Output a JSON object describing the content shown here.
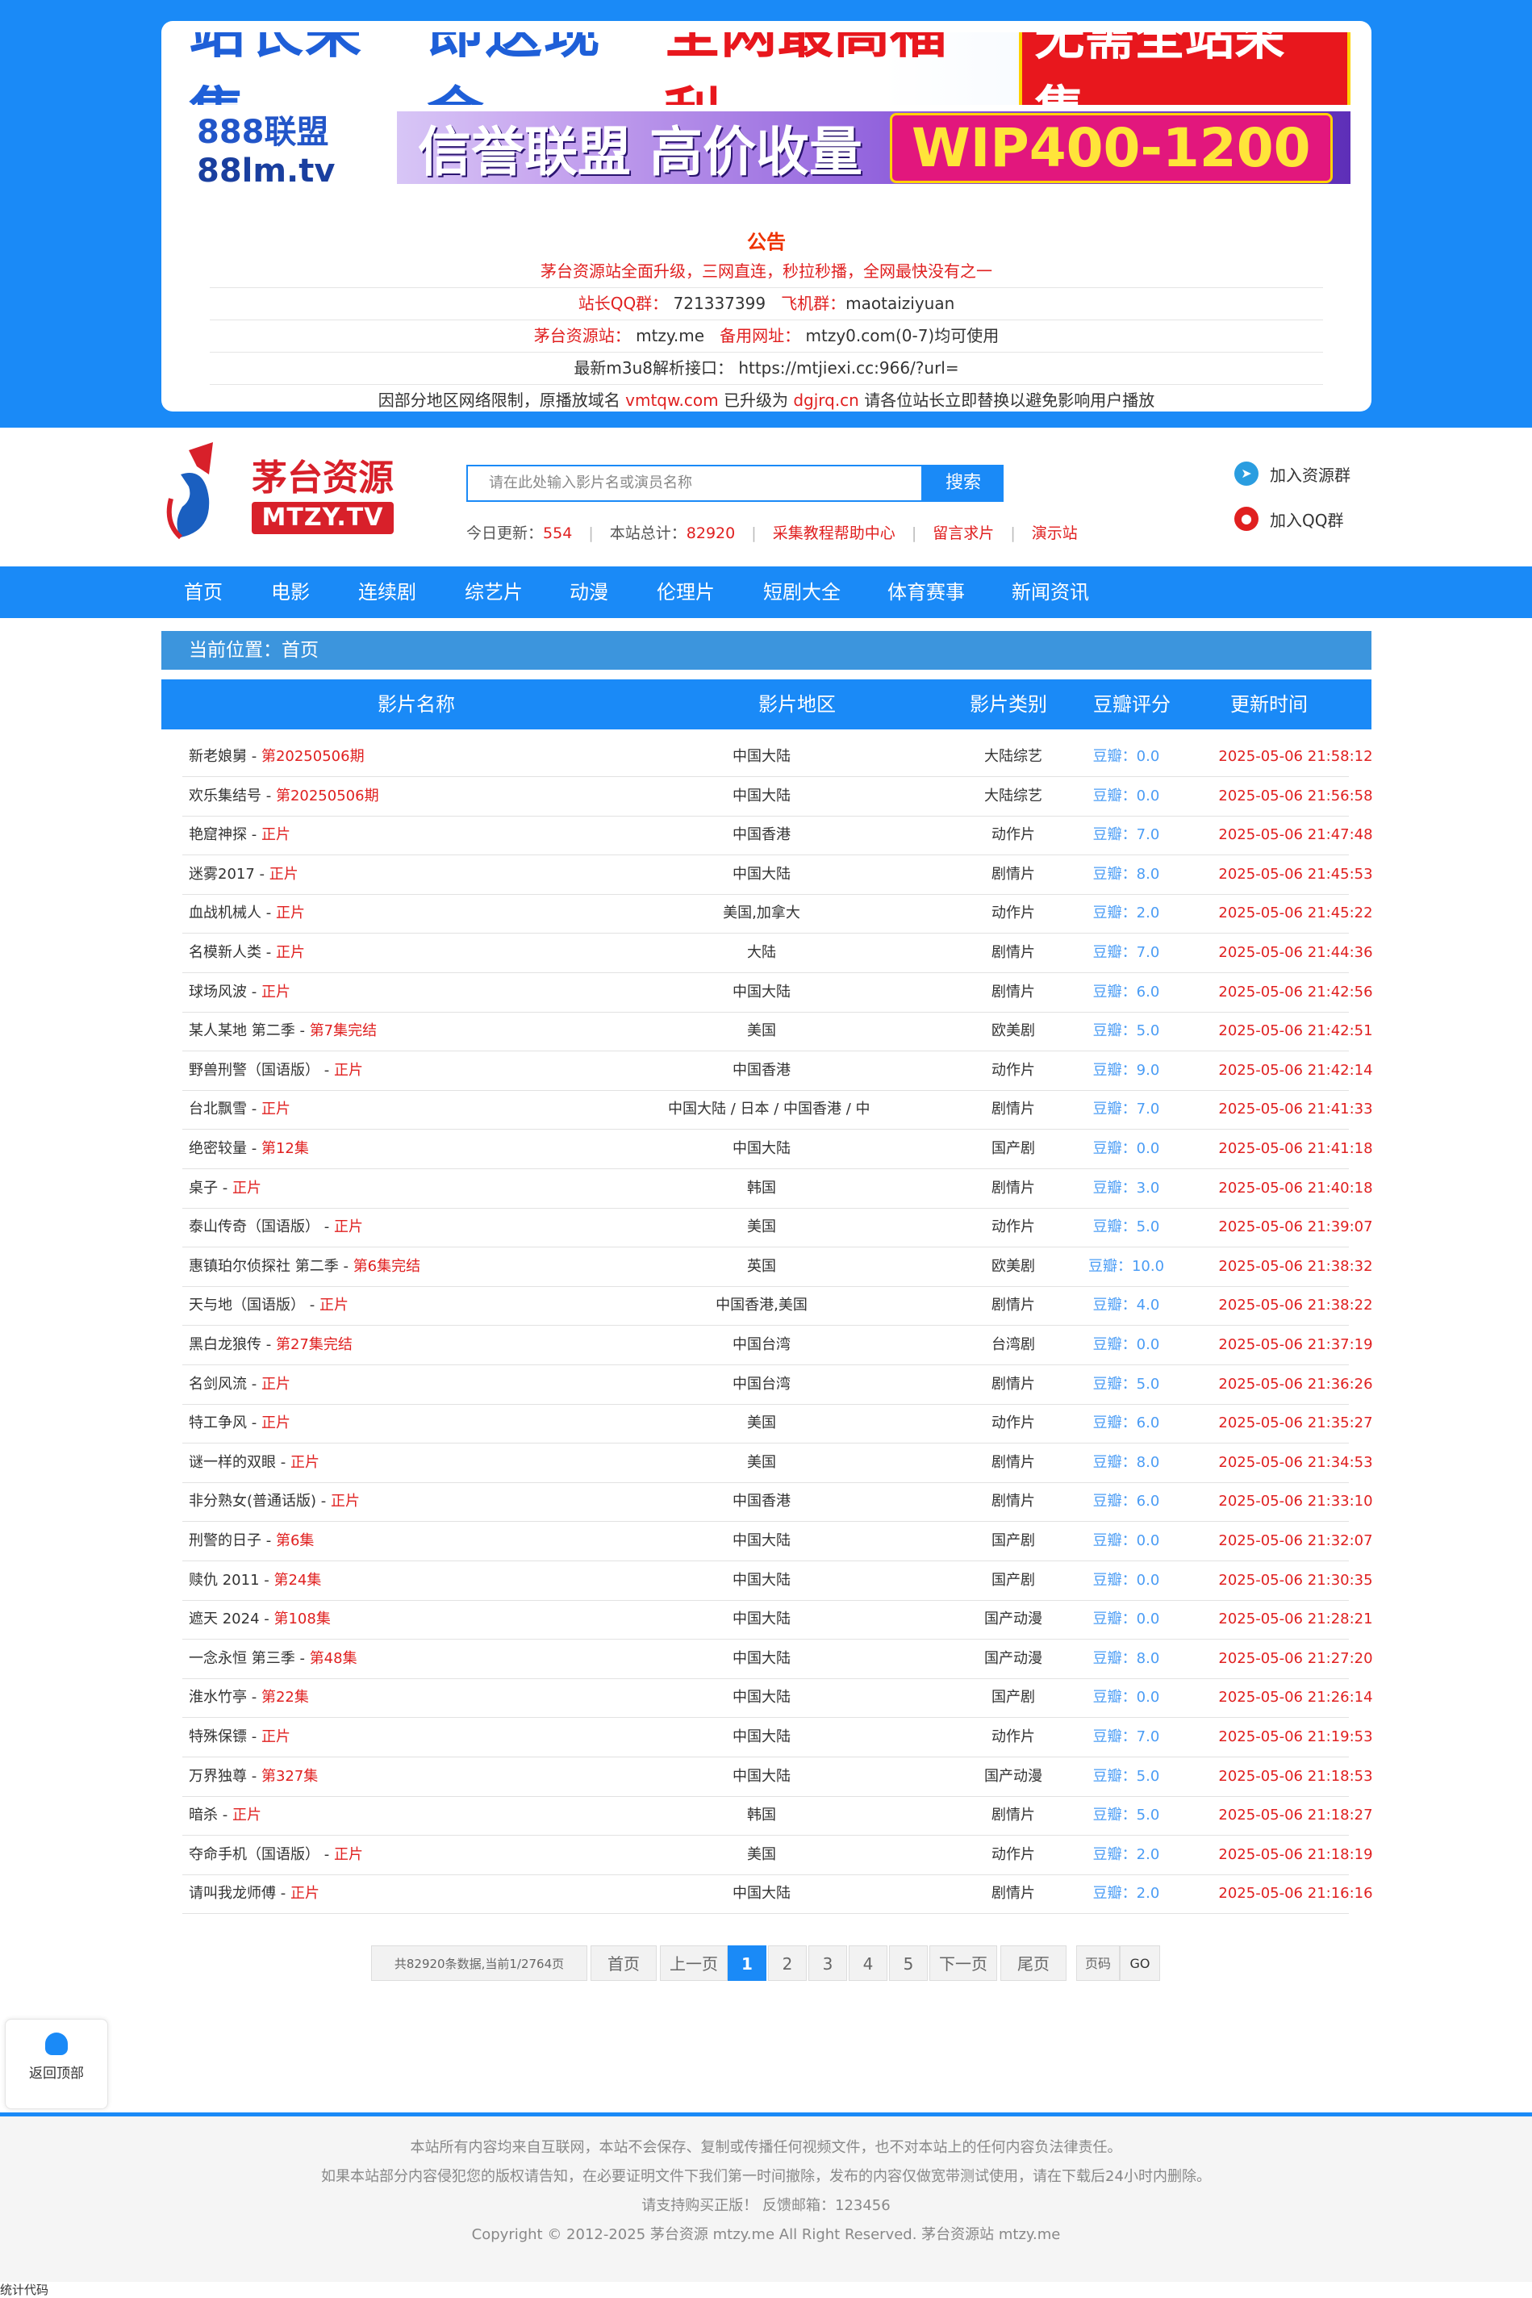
{
  "notice": {
    "banner1": {
      "blue": "站长采集",
      "red_text": "即送现金",
      "red_bold": "全网最高福利",
      "badge": "无需全站采集"
    },
    "banner2": {
      "logo_a": "888联盟",
      "logo_b": "88lm.tv",
      "slogan": "信誉联盟 高价收量",
      "badge": "WIP400-1200"
    },
    "title": "公告",
    "line1": "茅台资源站全面升级，三网直连，秒拉秒播，全网最快没有之一",
    "line2_a": "站长QQ群：",
    "line2_b": "721337399",
    "line2_c": "飞机群：",
    "line2_d": "maotaiziyuan",
    "line3_a": "茅台资源站：",
    "line3_b": "mtzy.me",
    "line3_c": "备用网址：",
    "line3_d": "mtzy0.com(0-7)均可使用",
    "line4": "最新m3u8解析接口：  https://mtjiexi.cc:966/?url=",
    "line5_a": "因部分地区网络限制，原播放域名",
    "line5_b": "vmtqw.com",
    "line5_c": "已升级为",
    "line5_d": "dgjrq.cn",
    "line5_e": "请各位站长立即替换以避免影响用户播放"
  },
  "header": {
    "logo_text": "茅台资源",
    "logo_sub": "MTZY.TV",
    "search_placeholder": "请在此处输入影片名或演员名称",
    "search_button": "搜索",
    "stats": {
      "today_label": "今日更新：",
      "today_value": "554",
      "total_label": "本站总计：",
      "total_value": "82920",
      "link1": "采集教程帮助中心",
      "link2": "留言求片",
      "link3": "演示站"
    },
    "join_group": "加入资源群",
    "join_qq": "加入QQ群"
  },
  "nav": [
    "首页",
    "电影",
    "连续剧",
    "综艺片",
    "动漫",
    "伦理片",
    "短剧大全",
    "体育赛事",
    "新闻资讯"
  ],
  "breadcrumb": {
    "label": "当前位置：",
    "current": "首页"
  },
  "table": {
    "headers": [
      "影片名称",
      "影片地区",
      "影片类别",
      "豆瓣评分",
      "更新时间"
    ],
    "rows": [
      {
        "name": "新老娘舅",
        "status": "第20250506期",
        "area": "中国大陆",
        "type": "大陆综艺",
        "score": "0.0",
        "time": "2025-05-06 21:58:12"
      },
      {
        "name": "欢乐集结号",
        "status": "第20250506期",
        "area": "中国大陆",
        "type": "大陆综艺",
        "score": "0.0",
        "time": "2025-05-06 21:56:58"
      },
      {
        "name": "艳窟神探",
        "status": "正片",
        "area": "中国香港",
        "type": "动作片",
        "score": "7.0",
        "time": "2025-05-06 21:47:48"
      },
      {
        "name": "迷雾2017",
        "status": "正片",
        "area": "中国大陆",
        "type": "剧情片",
        "score": "8.0",
        "time": "2025-05-06 21:45:53"
      },
      {
        "name": "血战机械人",
        "status": "正片",
        "area": "美国,加拿大",
        "type": "动作片",
        "score": "2.0",
        "time": "2025-05-06 21:45:22"
      },
      {
        "name": "名模新人类",
        "status": "正片",
        "area": "大陆",
        "type": "剧情片",
        "score": "7.0",
        "time": "2025-05-06 21:44:36"
      },
      {
        "name": "球场风波",
        "status": "正片",
        "area": "中国大陆",
        "type": "剧情片",
        "score": "6.0",
        "time": "2025-05-06 21:42:56"
      },
      {
        "name": "某人某地 第二季",
        "status": "第7集完结",
        "area": "美国",
        "type": "欧美剧",
        "score": "5.0",
        "time": "2025-05-06 21:42:51"
      },
      {
        "name": "野兽刑警（国语版）",
        "status": "正片",
        "area": "中国香港",
        "type": "动作片",
        "score": "9.0",
        "time": "2025-05-06 21:42:14"
      },
      {
        "name": "台北飘雪",
        "status": "正片",
        "area": "中国大陆 / 日本 / 中国香港 / 中",
        "type": "剧情片",
        "score": "7.0",
        "time": "2025-05-06 21:41:33"
      },
      {
        "name": "绝密较量",
        "status": "第12集",
        "area": "中国大陆",
        "type": "国产剧",
        "score": "0.0",
        "time": "2025-05-06 21:41:18"
      },
      {
        "name": "桌子",
        "status": "正片",
        "area": "韩国",
        "type": "剧情片",
        "score": "3.0",
        "time": "2025-05-06 21:40:18"
      },
      {
        "name": "泰山传奇（国语版）",
        "status": "正片",
        "area": "美国",
        "type": "动作片",
        "score": "5.0",
        "time": "2025-05-06 21:39:07"
      },
      {
        "name": "惠镇珀尔侦探社 第二季",
        "status": "第6集完结",
        "area": "英国",
        "type": "欧美剧",
        "score": "10.0",
        "time": "2025-05-06 21:38:32"
      },
      {
        "name": "天与地（国语版）",
        "status": "正片",
        "area": "中国香港,美国",
        "type": "剧情片",
        "score": "4.0",
        "time": "2025-05-06 21:38:22"
      },
      {
        "name": "黑白龙狼传",
        "status": "第27集完结",
        "area": "中国台湾",
        "type": "台湾剧",
        "score": "0.0",
        "time": "2025-05-06 21:37:19"
      },
      {
        "name": "名剑风流",
        "status": "正片",
        "area": "中国台湾",
        "type": "剧情片",
        "score": "5.0",
        "time": "2025-05-06 21:36:26"
      },
      {
        "name": "特工争风",
        "status": "正片",
        "area": "美国",
        "type": "动作片",
        "score": "6.0",
        "time": "2025-05-06 21:35:27"
      },
      {
        "name": "谜一样的双眼",
        "status": "正片",
        "area": "美国",
        "type": "剧情片",
        "score": "8.0",
        "time": "2025-05-06 21:34:53"
      },
      {
        "name": "非分熟女(普通话版)",
        "status": "正片",
        "area": "中国香港",
        "type": "剧情片",
        "score": "6.0",
        "time": "2025-05-06 21:33:10"
      },
      {
        "name": "刑警的日子",
        "status": "第6集",
        "area": "中国大陆",
        "type": "国产剧",
        "score": "0.0",
        "time": "2025-05-06 21:32:07"
      },
      {
        "name": "赎仇 2011",
        "status": "第24集",
        "area": "中国大陆",
        "type": "国产剧",
        "score": "0.0",
        "time": "2025-05-06 21:30:35"
      },
      {
        "name": "遮天 2024",
        "status": "第108集",
        "area": "中国大陆",
        "type": "国产动漫",
        "score": "0.0",
        "time": "2025-05-06 21:28:21"
      },
      {
        "name": "一念永恒 第三季",
        "status": "第48集",
        "area": "中国大陆",
        "type": "国产动漫",
        "score": "8.0",
        "time": "2025-05-06 21:27:20"
      },
      {
        "name": "淮水竹亭",
        "status": "第22集",
        "area": "中国大陆",
        "type": "国产剧",
        "score": "0.0",
        "time": "2025-05-06 21:26:14"
      },
      {
        "name": "特殊保镖",
        "status": "正片",
        "area": "中国大陆",
        "type": "动作片",
        "score": "7.0",
        "time": "2025-05-06 21:19:53"
      },
      {
        "name": "万界独尊",
        "status": "第327集",
        "area": "中国大陆",
        "type": "国产动漫",
        "score": "5.0",
        "time": "2025-05-06 21:18:53"
      },
      {
        "name": "暗杀",
        "status": "正片",
        "area": "韩国",
        "type": "剧情片",
        "score": "5.0",
        "time": "2025-05-06 21:18:27"
      },
      {
        "name": "夺命手机（国语版）",
        "status": "正片",
        "area": "美国",
        "type": "动作片",
        "score": "2.0",
        "time": "2025-05-06 21:18:19"
      },
      {
        "name": "请叫我龙师傅",
        "status": "正片",
        "area": "中国大陆",
        "type": "剧情片",
        "score": "2.0",
        "time": "2025-05-06 21:16:16"
      }
    ],
    "score_prefix": "豆瓣："
  },
  "pager": {
    "summary": "共82920条数据,当前1/2764页",
    "first": "首页",
    "prev": "上一页",
    "pages": [
      "1",
      "2",
      "3",
      "4",
      "5"
    ],
    "next": "下一页",
    "last": "尾页",
    "page_label": "页码",
    "go": "GO"
  },
  "backtop": "返回顶部",
  "footer": {
    "line1": "本站所有内容均来自互联网，本站不会保存、复制或传播任何视频文件，也不对本站上的任何内容负法律责任。",
    "line2": "如果本站部分内容侵犯您的版权请告知，在必要证明文件下我们第一时间撤除，发布的内容仅做宽带测试使用，请在下载后24小时内删除。",
    "line3": "请支持购买正版！ 反馈邮箱：123456",
    "line4": "Copyright © 2012-2025 茅台资源  mtzy.me   All Right Reserved. 茅台资源站 mtzy.me"
  },
  "stat_code": "统计代码",
  "colors": {
    "primary": "#1a8af7",
    "accent_red": "#e02020",
    "score_blue": "#4a9cf5"
  }
}
